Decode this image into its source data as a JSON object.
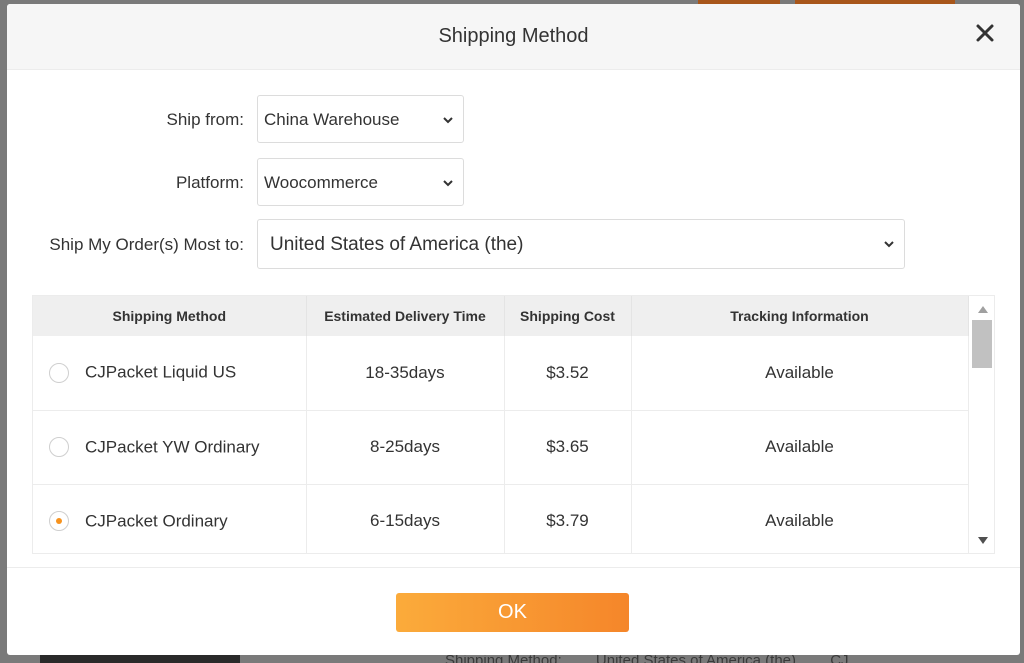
{
  "background": {
    "text_items": [
      "Shipping Method:",
      "United States of America (the)",
      "CJ"
    ]
  },
  "dialog": {
    "title": "Shipping Method",
    "ship_from_label": "Ship from:",
    "ship_from_value": "China Warehouse",
    "platform_label": "Platform:",
    "platform_value": "Woocommerce",
    "ship_to_label": "Ship My Order(s) Most to:",
    "ship_to_value": "United States of America (the)",
    "table": {
      "headers": [
        "Shipping Method",
        "Estimated Delivery Time",
        "Shipping Cost",
        "Tracking Information"
      ],
      "rows": [
        {
          "method": "CJPacket Liquid US",
          "time": "18-35days",
          "cost": "$3.52",
          "tracking": "Available",
          "selected": false
        },
        {
          "method": "CJPacket YW Ordinary",
          "time": "8-25days",
          "cost": "$3.65",
          "tracking": "Available",
          "selected": false
        },
        {
          "method": "CJPacket Ordinary",
          "time": "6-15days",
          "cost": "$3.79",
          "tracking": "Available",
          "selected": true
        }
      ]
    },
    "ok_label": "OK"
  },
  "colors": {
    "accent": "#f7931e",
    "ok_gradient_start": "#fbab3b",
    "ok_gradient_end": "#f5862a"
  },
  "icons": {
    "close": "close-icon",
    "dropdown": "chevron-down-icon",
    "scroll_up": "triangle-up-icon",
    "scroll_down": "triangle-down-icon"
  }
}
